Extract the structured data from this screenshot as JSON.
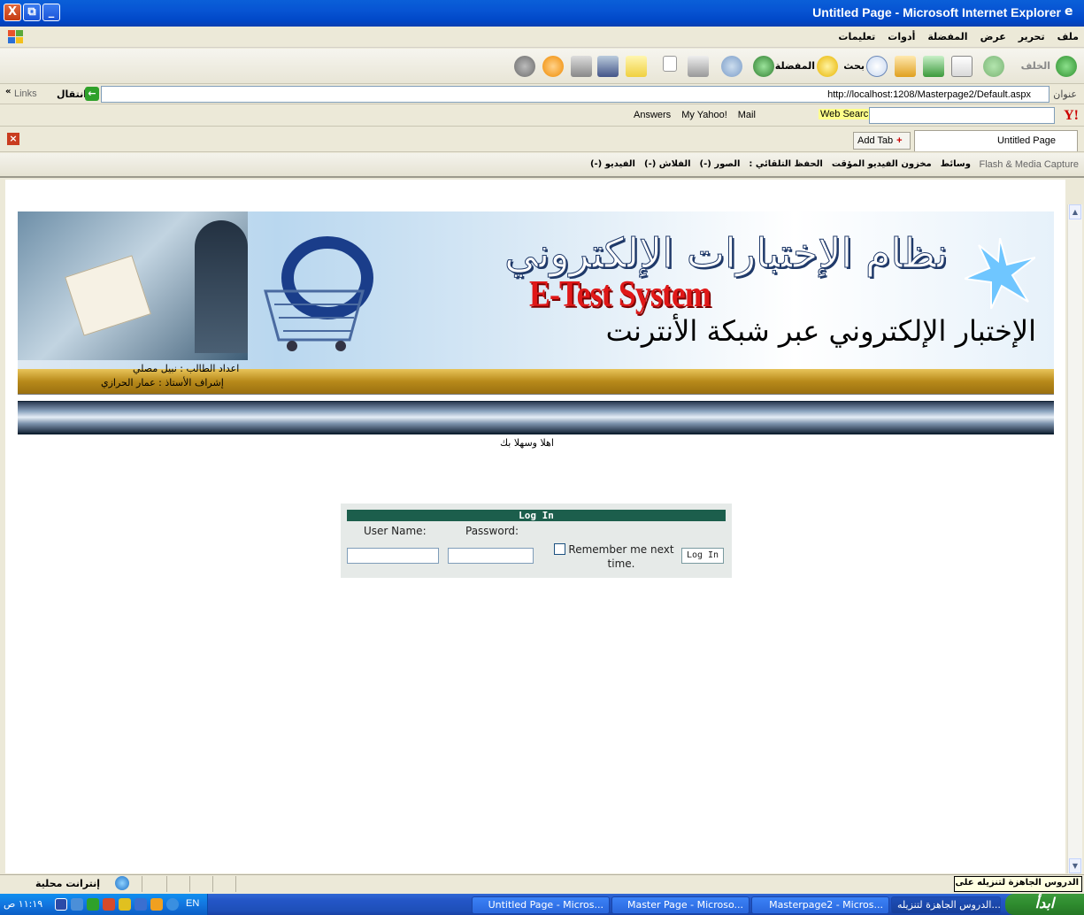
{
  "window": {
    "title": "Untitled Page - Microsoft Internet Explorer",
    "minimize": "_",
    "restore": "⧉",
    "close": "X"
  },
  "menu": {
    "items": [
      "ملف",
      "تحرير",
      "عرض",
      "المفضلة",
      "أدوات",
      "تعليمات"
    ]
  },
  "toolbar": {
    "back": "الخلف",
    "search": "بحث",
    "favorites": "المفضلة"
  },
  "address": {
    "label": "عنوان",
    "url": "http://localhost:1208/Masterpage2/Default.aspx",
    "go": "انتقال",
    "links": "Links"
  },
  "yahoo": {
    "web_search": "Web Search",
    "mail": "Mail",
    "my_yahoo": "My Yahoo!",
    "answers": "Answers",
    "logo": "Y!"
  },
  "tabs": {
    "active": "Untitled Page",
    "add": "Add Tab"
  },
  "flashbar": {
    "label": "Flash & Media Capture",
    "items": [
      "وسائط",
      "مخزون الفيديو المؤقت",
      "الحفظ التلقائي :",
      "الصور (-)",
      "الفلاش (-)",
      "الفيديو (-)"
    ]
  },
  "banner": {
    "title_ar": "نظام الإختبارات الإلكتروني",
    "title_en": "E-Test System",
    "subtitle_ar": "الإختبار الإلكتروني عبر شبكة الأنترنت",
    "credit_student": "اعداد الطالب : نبيل مصلي",
    "credit_supervisor": "إشراف الأستاذ : عمار الحرازي"
  },
  "welcome": "اهلا وسهلا بك",
  "login": {
    "heading": "Log In",
    "username_label": "User Name:",
    "password_label": "Password:",
    "remember_label": "Remember me next time.",
    "button": "Log In",
    "username_value": "",
    "password_value": ""
  },
  "status": {
    "zone": "إنترانت محلية",
    "tooltip": "الدروس الجاهزة لتنزيله على النت"
  },
  "taskbar": {
    "start": "ابدأ",
    "clock": "١١:١٩ ص",
    "lang": "EN",
    "tasks": [
      "الدروس الجاهزة لتنزيله...",
      "Masterpage2 - Micros...",
      "Master Page - Microso...",
      "Untitled Page - Micros..."
    ]
  },
  "colors": {
    "login_header": "#1c5e4c",
    "banner_en": "#e01818",
    "gold_bar": "#b88a1a",
    "xp_blue": "#0754d3"
  }
}
